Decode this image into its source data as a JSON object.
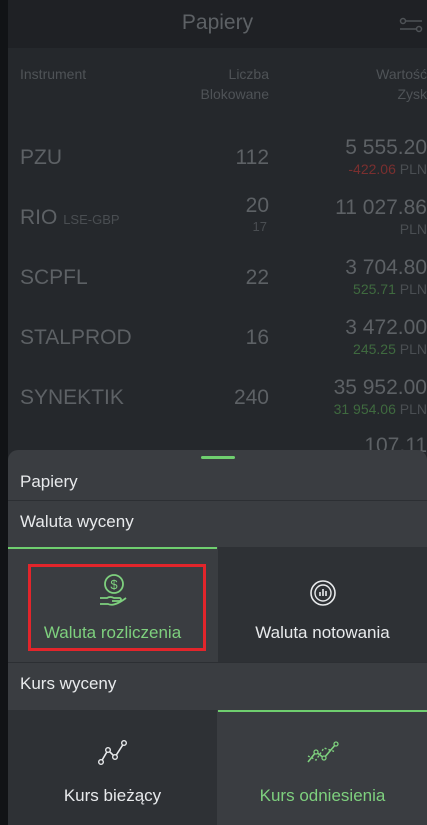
{
  "header": {
    "title": "Papiery"
  },
  "columns": {
    "instrument": "Instrument",
    "qty_line1": "Liczba",
    "qty_line2": "Blokowane",
    "value_line1": "Wartość",
    "value_line2": "Zysk"
  },
  "rows": [
    {
      "name": "PZU",
      "sub": "",
      "qty": "112",
      "qty2": "",
      "value": "5 555.20",
      "pl": "-422.06",
      "currency": "PLN"
    },
    {
      "name": "RIO",
      "sub": "LSE-GBP",
      "qty": "20",
      "qty2": "17",
      "value": "11 027.86",
      "pl": "",
      "currency": "PLN"
    },
    {
      "name": "SCPFL",
      "sub": "",
      "qty": "22",
      "qty2": "",
      "value": "3 704.80",
      "pl": "525.71",
      "currency": "PLN"
    },
    {
      "name": "STALPROD",
      "sub": "",
      "qty": "16",
      "qty2": "",
      "value": "3 472.00",
      "pl": "245.25",
      "currency": "PLN"
    },
    {
      "name": "SYNEKTIK",
      "sub": "",
      "qty": "240",
      "qty2": "",
      "value": "35 952.00",
      "pl": "31 954.06",
      "currency": "PLN"
    },
    {
      "name": "",
      "sub": "",
      "qty": "",
      "qty2": "",
      "value": "107.11",
      "pl": "",
      "currency": ""
    }
  ],
  "sheet": {
    "title": "Papiery",
    "valuation_currency": {
      "label": "Waluta wyceny",
      "options": [
        {
          "label": "Waluta rozliczenia",
          "icon": "money-hand-icon",
          "active": true
        },
        {
          "label": "Waluta notowania",
          "icon": "chart-circle-icon",
          "active": false
        }
      ]
    },
    "valuation_rate": {
      "label": "Kurs wyceny",
      "options": [
        {
          "label": "Kurs bieżący",
          "icon": "line-chart-icon",
          "active": false
        },
        {
          "label": "Kurs odniesienia",
          "icon": "line-chart-dashed-icon",
          "active": true
        }
      ]
    }
  },
  "colors": {
    "accent": "#6fcf6f",
    "highlight": "#e2252b",
    "negative": "#c0392b",
    "positive": "#4caf50"
  }
}
